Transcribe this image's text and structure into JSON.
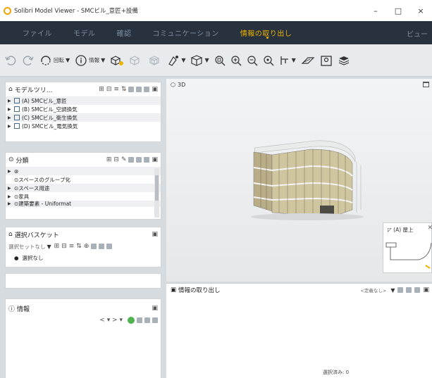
{
  "window": {
    "title": "Solibri Model Viewer - SMCビル_意匠+設備",
    "minimize": "–",
    "maximize": "□",
    "close": "×"
  },
  "menu": {
    "items": [
      "ファイル",
      "モデル",
      "確認",
      "コミュニケーション",
      "情報の取り出し"
    ],
    "active_index": 4,
    "right": "ビュー"
  },
  "toolbar": {
    "rotate_label": "回転",
    "info_label": "情報"
  },
  "model_tree": {
    "title": "モデルツリ...",
    "rows": [
      "(A) SMCビル_意匠",
      "(B) SMCビル_空調換気",
      "(C) SMCビル_衛生換気",
      "(D) SMCビル_電気換気"
    ]
  },
  "classification": {
    "title": "分類",
    "rows": [
      "",
      "スペースのグループ化",
      "スペース用途",
      "家具",
      "建築要素 - Uniformat"
    ]
  },
  "basket": {
    "title": "選択バスケット",
    "set_label": "選択セットなし",
    "item": "選択なし"
  },
  "info": {
    "title": "情報",
    "nav": "< ▾ > ▾"
  },
  "viewport": {
    "title": "3D"
  },
  "plan": {
    "label": "(A) 屋上"
  },
  "extract": {
    "title": "情報の取り出し",
    "dropdown": "<定義なし>",
    "status": "選択済み: 0"
  },
  "colors": {
    "menubar": "#27323e",
    "accent": "#f0b400"
  }
}
